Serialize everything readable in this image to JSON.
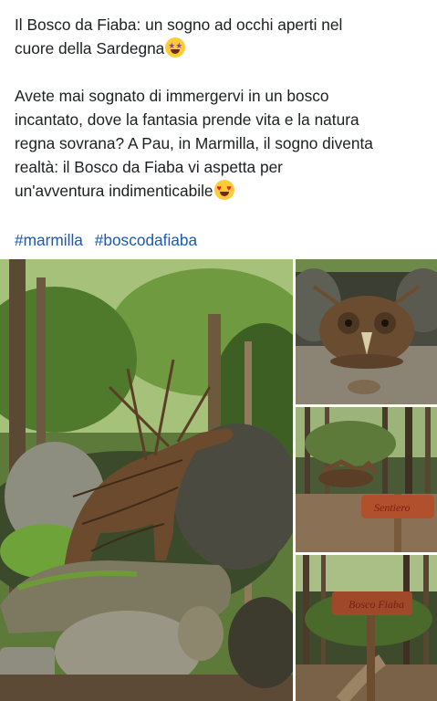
{
  "post": {
    "title_line1": "Il Bosco da Fiaba: un sogno ad occhi aperti nel",
    "title_line2": "cuore della Sardegna",
    "title_emoji": "star-struck-emoji",
    "body_lines": [
      "Avete mai sognato di immergervi in un bosco",
      "incantato, dove la fantasia prende vita e la natura",
      "regna sovrana? A Pau, in Marmilla, il sogno diventa",
      "realtà: il Bosco da Fiaba vi aspetta per",
      "un'avventura indimenticabile"
    ],
    "body_emoji": "heart-eyes-emoji",
    "hashtags": [
      "#marmilla",
      "#boscodafiaba"
    ],
    "link_color": "#1b5ab0"
  },
  "photos": [
    {
      "name": "photo-deer-sculpture",
      "icon": "wicker-deer-sculpture-in-forest"
    },
    {
      "name": "photo-owl-sculpture",
      "icon": "wicker-owl-sculpture"
    },
    {
      "name": "photo-forest-sign",
      "icon": "forest-trail-with-wooden-sign"
    },
    {
      "name": "photo-forest-sign-2",
      "icon": "forest-trail-with-wooden-sign"
    }
  ]
}
